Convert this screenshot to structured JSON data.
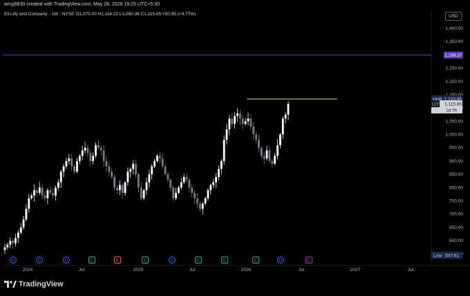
{
  "header": {
    "created_line": "amyj9830 created with TradingView.com, May 28, 2026 19:25 UTC+5:30",
    "symbol": "Eli Lilly and Company · 1W · NYSE",
    "open": "O1,075.00",
    "high": "H1,116.22",
    "low": "L1,060.36",
    "close": "C1,115.85",
    "change": "+50.85 (+4.77%)"
  },
  "currency_button": "USD",
  "brand": "TradingView",
  "price_axis": {
    "ticks": [
      "1,400.00",
      "1,350.00",
      "1,300.00",
      "1,250.00",
      "1,200.00",
      "1,150.00",
      "1,100.00",
      "1,050.00",
      "1,000.00",
      "950.00",
      "900.00",
      "850.00",
      "800.00",
      "750.00",
      "700.00",
      "650.00",
      "600.00",
      "550.00"
    ],
    "tick_values": [
      1400,
      1350,
      1300,
      1250,
      1200,
      1150,
      1100,
      1050,
      1000,
      950,
      900,
      850,
      800,
      750,
      700,
      650,
      600,
      550
    ]
  },
  "time_axis": {
    "labels": [
      "2024",
      "Jul",
      "2025",
      "Jul",
      "2026",
      "Jul",
      "2027",
      "Jul"
    ]
  },
  "labels": {
    "alert_price": "1,299.37",
    "high_label": "High",
    "high_value": "1,133.95",
    "symbol_ticker": "LLY",
    "last_price": "1,115.85",
    "countdown": "1d 7h",
    "low_label": "Low",
    "low_value": "547.61"
  },
  "event_markers": [
    "D",
    "D",
    "D",
    "E",
    "E",
    "E",
    "D",
    "E",
    "E",
    "E",
    "D",
    "E"
  ],
  "colors": {
    "background": "#000000",
    "candle": "#ffffff",
    "candle_down": "#787b86",
    "alert_line": "#5b4ab0",
    "alert_badge": "#5b3bb8",
    "high_line": "#e8d08c",
    "marker_dividend": "#2962ff",
    "marker_earnings_green": "#26a69a",
    "marker_earnings_red": "#ef5350",
    "marker_future": "#9c27b0"
  },
  "chart_data": {
    "type": "candlestick",
    "series": [
      {
        "name": "LLY",
        "values": [
          575,
          585,
          600,
          590,
          610,
          630,
          650,
          680,
          720,
          760,
          770,
          790,
          780,
          800,
          770,
          760,
          790,
          780,
          770,
          800,
          820,
          860,
          880,
          900,
          910,
          880,
          860,
          900,
          920,
          940,
          950,
          930,
          900,
          920,
          960,
          950,
          940,
          900,
          880,
          860,
          840,
          800,
          790,
          810,
          780,
          820,
          860,
          870,
          890,
          850,
          800,
          760,
          790,
          820,
          850,
          880,
          900,
          920,
          910,
          880,
          850,
          830,
          800,
          760,
          780,
          800,
          820,
          840,
          830,
          800,
          780,
          760,
          740,
          720,
          740,
          760,
          790,
          810,
          820,
          840,
          870,
          900,
          980,
          1020,
          1060,
          1040,
          1070,
          1080,
          1060,
          1040,
          1050,
          1060,
          1030,
          1000,
          980,
          950,
          920,
          910,
          940,
          900,
          890,
          920,
          960,
          1000,
          1060,
          1075,
          1116
        ]
      }
    ],
    "ylim": [
      547.61,
      1420
    ],
    "high": 1133.95,
    "low": 547.61,
    "last": 1115.85,
    "alert_level": 1299.37
  }
}
